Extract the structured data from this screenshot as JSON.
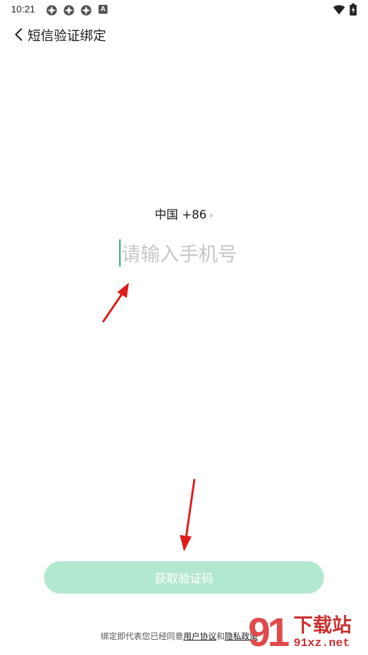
{
  "status_bar": {
    "time": "10:21",
    "icons": [
      "app-notification-icon",
      "app-notification-icon",
      "app-notification-icon",
      "a-badge-icon",
      "wifi-icon",
      "battery-icon"
    ],
    "a_badge": "A"
  },
  "header": {
    "title": "短信验证绑定",
    "back_icon": "chevron-left-icon"
  },
  "form": {
    "country": "中国 +86",
    "country_chevron": "›",
    "phone_placeholder": "请输入手机号",
    "phone_value": ""
  },
  "button": {
    "get_code_label": "获取验证码"
  },
  "agreement": {
    "prefix": "绑定即代表您已经同意",
    "user_agreement": "用户协议",
    "and": "和",
    "privacy_policy": "隐私政策"
  },
  "watermark": {
    "number": "91",
    "site_name": "下载站",
    "domain": "91xz.net"
  },
  "colors": {
    "accent": "#2bb673",
    "button_disabled": "#b3e8d0",
    "annotation_arrow": "#e01b1b",
    "watermark": "#c93030"
  }
}
